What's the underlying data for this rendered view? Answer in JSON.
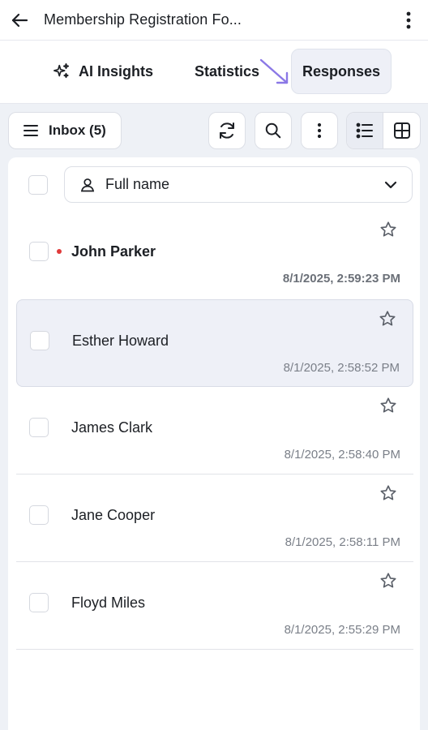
{
  "header": {
    "title": "Membership Registration Fo...",
    "back_icon": "arrow-left-icon",
    "menu_icon": "more-vertical-icon"
  },
  "tabs": [
    {
      "label": "AI Insights",
      "icon": "sparkles-icon",
      "active": false
    },
    {
      "label": "Statistics",
      "active": false
    },
    {
      "label": "Responses",
      "active": true
    }
  ],
  "toolbar": {
    "inbox_label": "Inbox (5)",
    "menu_icon": "hamburger-icon",
    "refresh_icon": "refresh-icon",
    "search_icon": "search-icon",
    "more_icon": "more-vertical-icon",
    "list_view_icon": "list-view-icon",
    "grid_view_icon": "grid-view-icon",
    "active_view": "list"
  },
  "filter": {
    "field_label": "Full name",
    "icon": "user-icon"
  },
  "responses": [
    {
      "name": "John Parker",
      "date": "8/1/2025, 2:59:23 PM",
      "unread": true,
      "selected": false
    },
    {
      "name": "Esther Howard",
      "date": "8/1/2025, 2:58:52 PM",
      "unread": false,
      "selected": true
    },
    {
      "name": "James Clark",
      "date": "8/1/2025, 2:58:40 PM",
      "unread": false,
      "selected": false
    },
    {
      "name": "Jane Cooper",
      "date": "8/1/2025, 2:58:11 PM",
      "unread": false,
      "selected": false
    },
    {
      "name": "Floyd Miles",
      "date": "8/1/2025, 2:55:29 PM",
      "unread": false,
      "selected": false
    }
  ],
  "colors": {
    "accent_arrow": "#8b78e6",
    "unread_dot": "#e03a3a",
    "selected_row_bg": "#eef0f7",
    "page_bg": "#eef1f6"
  }
}
